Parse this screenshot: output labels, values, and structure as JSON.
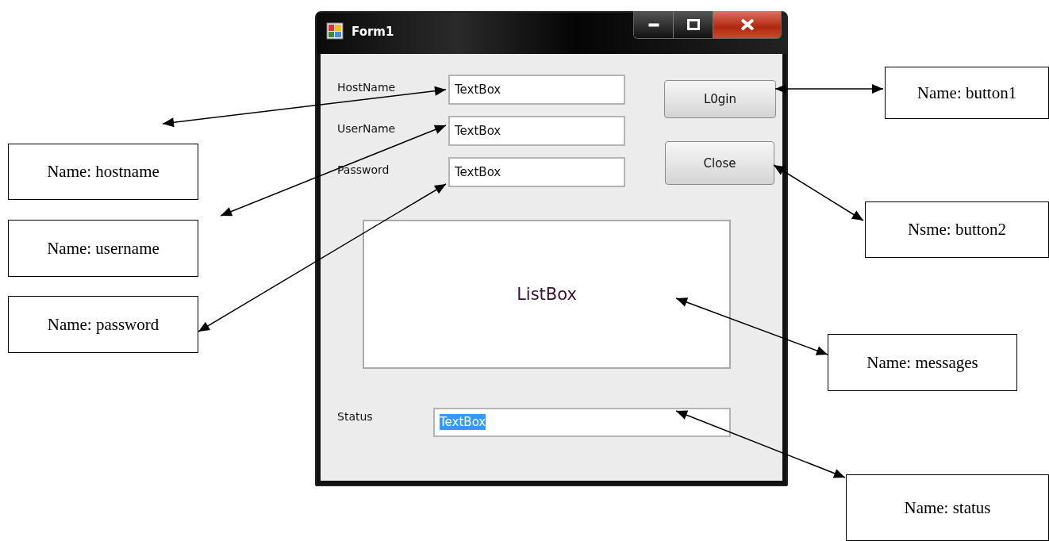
{
  "window": {
    "title": "Form1"
  },
  "fields": [
    {
      "label": "HostName",
      "value": "TextBox"
    },
    {
      "label": "UserName",
      "value": "TextBox"
    },
    {
      "label": "Password",
      "value": "TextBox"
    }
  ],
  "buttons": [
    "L0gin",
    "Close"
  ],
  "list_box": {
    "text": "ListBox"
  },
  "status": {
    "label": "Status",
    "value": "TextBox",
    "text_selected": true
  },
  "callouts": [
    {
      "text": "Name: button1"
    },
    {
      "text": "Name: hostname"
    },
    {
      "text": "Name: username"
    },
    {
      "text": "Name: password"
    },
    {
      "text": "Nsme: button2"
    },
    {
      "text": "Name: messages"
    },
    {
      "text": "Name: status"
    }
  ]
}
